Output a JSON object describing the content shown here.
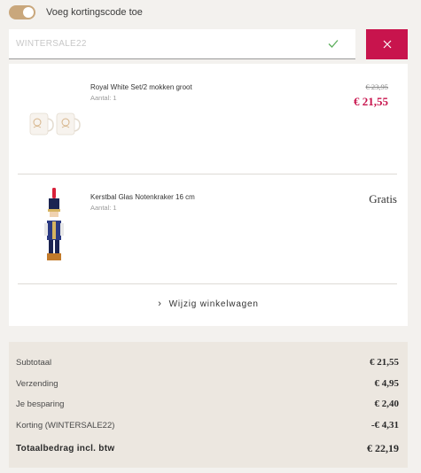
{
  "coupon": {
    "toggle_label": "Voeg kortingscode toe",
    "toggle_on": true,
    "code_value": "WINTERSALE22",
    "accent_color": "#c8144d",
    "check_icon": "check-icon",
    "remove_icon": "close-icon"
  },
  "items": [
    {
      "name": "Royal White Set/2 mokken groot",
      "quantity": "Aantal: 1",
      "old_price": "€ 23,95",
      "price": "€ 21,55"
    },
    {
      "name": "Kerstbal Glas Notenkraker 16 cm",
      "quantity": "Aantal: 1",
      "price": "Gratis"
    }
  ],
  "edit_cart": {
    "label": "Wijzig winkelwagen",
    "icon": "chevron-right-icon"
  },
  "summary": {
    "rows": [
      {
        "label": "Subtotaal",
        "value": "€ 21,55"
      },
      {
        "label": "Verzending",
        "value": "€ 4,95"
      },
      {
        "label": "Je besparing",
        "value": "€ 2,40"
      },
      {
        "label": "Korting (WINTERSALE22)",
        "value": "-€ 4,31"
      },
      {
        "label": "Totaalbedrag incl. btw",
        "value": "€ 22,19"
      }
    ]
  }
}
